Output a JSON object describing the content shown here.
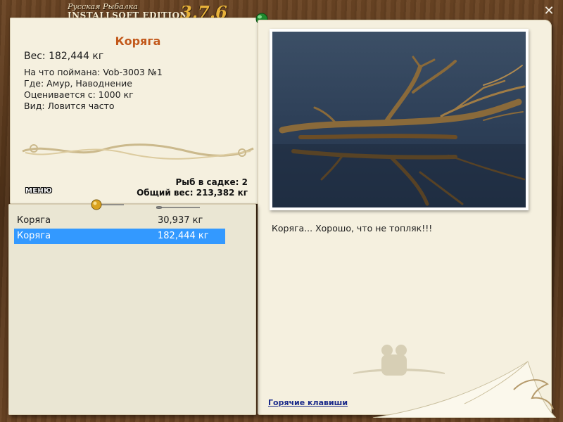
{
  "app": {
    "title_small": "Русская Рыбалка",
    "title_edition": "INSTALLSOFT EDITION",
    "version": "3.7.6"
  },
  "fish": {
    "name": "Коряга",
    "weight": "Вес: 182,444 кг",
    "caught_on": "На что поймана: Vob-3003 №1",
    "where": "Где: Амур, Наводнение",
    "valued_from": "Оценивается с: 1000 кг",
    "kind": "Вид: Ловится часто"
  },
  "keepnet": {
    "count": "Рыб в садке: 2",
    "total_weight": "Общий вес: 213,382 кг"
  },
  "menu_label": "МЕНЮ",
  "catch_list": [
    {
      "name": "Коряга",
      "weight": "30,937 кг",
      "selected": false
    },
    {
      "name": "Коряга",
      "weight": "182,444 кг",
      "selected": true
    }
  ],
  "caption": "Коряга... Хорошо, что не топляк!!!",
  "hotkeys_label": "Горячие клавиши",
  "colors": {
    "accent_title": "#c2581a",
    "selection": "#3399ff",
    "link": "#1a2a8a",
    "paper": "#f5f0df",
    "wood": "#5a3a1e"
  }
}
